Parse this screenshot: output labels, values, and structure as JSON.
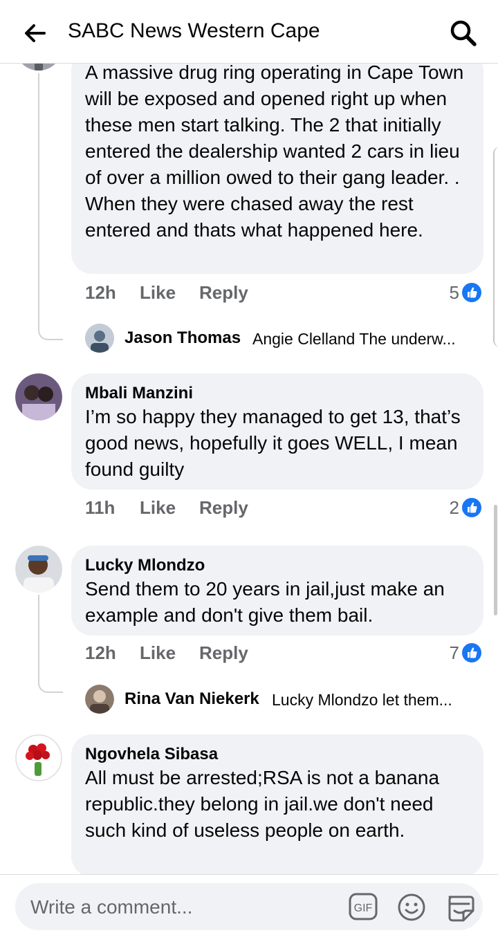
{
  "header": {
    "title": "SABC News Western Cape",
    "back_icon": "arrow-left-icon",
    "search_icon": "search-icon"
  },
  "colors": {
    "like_blue": "#1877f2",
    "bubble_bg": "#f0f2f5",
    "meta_gray": "#65676b",
    "thread_line": "#d0d2d6"
  },
  "comments": [
    {
      "author": "",
      "text": "A massive drug ring operating in Cape Town will be exposed and opened right up when these men start talking. The 2 that initially entered the dealership wanted 2 cars in lieu of over a million owed to their gang leader. . When they were chased away the rest entered and thats what happened here.",
      "time": "12h",
      "like_label": "Like",
      "reply_label": "Reply",
      "reaction_count": "5",
      "reply_preview": {
        "author": "Jason Thomas",
        "snippet": "Angie Clelland The underw..."
      }
    },
    {
      "author": "Mbali Manzini",
      "text": "I’m so happy they managed to get 13, that’s good news, hopefully it goes WELL, I mean found guilty",
      "time": "11h",
      "like_label": "Like",
      "reply_label": "Reply",
      "reaction_count": "2"
    },
    {
      "author": "Lucky Mlondzo",
      "text": "Send them to 20 years in jail,just make an example and don't give them bail.",
      "time": "12h",
      "like_label": "Like",
      "reply_label": "Reply",
      "reaction_count": "7",
      "reply_preview": {
        "author": "Rina Van Niekerk",
        "snippet": "Lucky Mlondzo let them..."
      }
    },
    {
      "author": "Ngovhela Sibasa",
      "text": "All  must be arrested;RSA is not a banana republic.they belong in jail.we don't need such kind of useless people on earth."
    }
  ],
  "composer": {
    "placeholder": "Write a comment...",
    "gif_label": "GIF",
    "emoji_icon": "smiley-icon",
    "sticker_icon": "sticker-icon"
  }
}
